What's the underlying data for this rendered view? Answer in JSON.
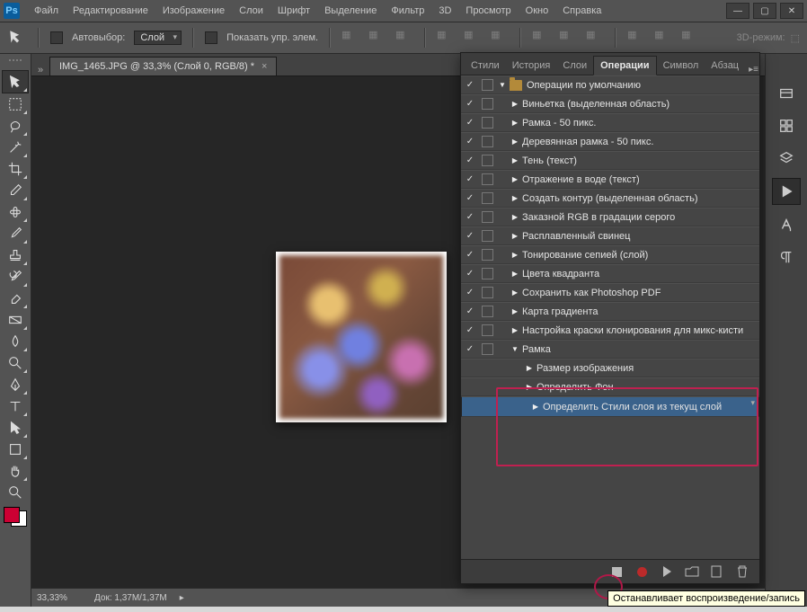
{
  "menu": [
    "Файл",
    "Редактирование",
    "Изображение",
    "Слои",
    "Шрифт",
    "Выделение",
    "Фильтр",
    "3D",
    "Просмотр",
    "Окно",
    "Справка"
  ],
  "options": {
    "autoselect": "Автовыбор:",
    "layer": "Слой",
    "show_controls": "Показать упр. элем.",
    "mode3d": "3D-режим:"
  },
  "doc": {
    "tab": "IMG_1465.JPG @ 33,3% (Слой 0, RGB/8) *"
  },
  "status": {
    "zoom": "33,33%",
    "doc": "Док: 1,37M/1,37M"
  },
  "panel_tabs": [
    "Стили",
    "История",
    "Слои",
    "Операции",
    "Символ",
    "Абзац"
  ],
  "panel_active": 3,
  "actions": {
    "root": "Операции по умолчанию",
    "items": [
      "Виньетка (выделенная область)",
      "Рамка - 50 пикс.",
      "Деревянная рамка - 50 пикс.",
      "Тень (текст)",
      "Отражение в воде (текст)",
      "Создать контур (выделенная область)",
      "Заказной RGB в градации серого",
      "Расплавленный свинец",
      "Тонирование сепией (слой)",
      "Цвета квадранта",
      "Сохранить как Photoshop PDF",
      "Карта градиента",
      "Настройка краски клонирования для микс-кисти"
    ],
    "custom": "Рамка",
    "steps": [
      "Размер изображения",
      "Определить Фон",
      "Определить Стили слоя из текущ слой"
    ]
  },
  "tooltip": "Останавливает воспроизведение/запись"
}
